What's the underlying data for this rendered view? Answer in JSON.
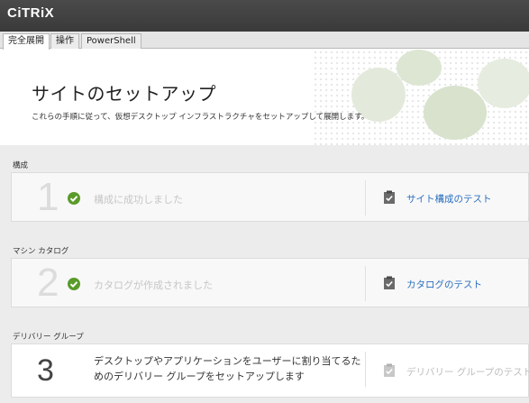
{
  "app": {
    "logo": "CiTRiX",
    "logo_mark": "."
  },
  "tabs": [
    {
      "label": "完全展開",
      "active": true
    },
    {
      "label": "操作",
      "active": false
    },
    {
      "label": "PowerShell",
      "active": false
    }
  ],
  "hero": {
    "title": "サイトのセットアップ",
    "subtitle": "これらの手順に従って、仮想デスクトップ インフラストラクチャをセットアップして展開します。"
  },
  "sections": [
    {
      "label": "構成",
      "step": "1",
      "status": "構成に成功しました",
      "completed": true,
      "test_label": "サイト構成のテスト",
      "test_enabled": true
    },
    {
      "label": "マシン カタログ",
      "step": "2",
      "status": "カタログが作成されました",
      "completed": true,
      "test_label": "カタログのテスト",
      "test_enabled": true
    },
    {
      "label": "デリバリー グループ",
      "step": "3",
      "status": "デスクトップやアプリケーションをユーザーに割り当てるためのデリバリー グループをセットアップします",
      "completed": false,
      "test_label": "デリバリー グループのテスト",
      "test_enabled": false
    }
  ],
  "colors": {
    "accent": "#2a6fbf",
    "success": "#5a9b2a",
    "topbar": "#3f3f3f"
  }
}
